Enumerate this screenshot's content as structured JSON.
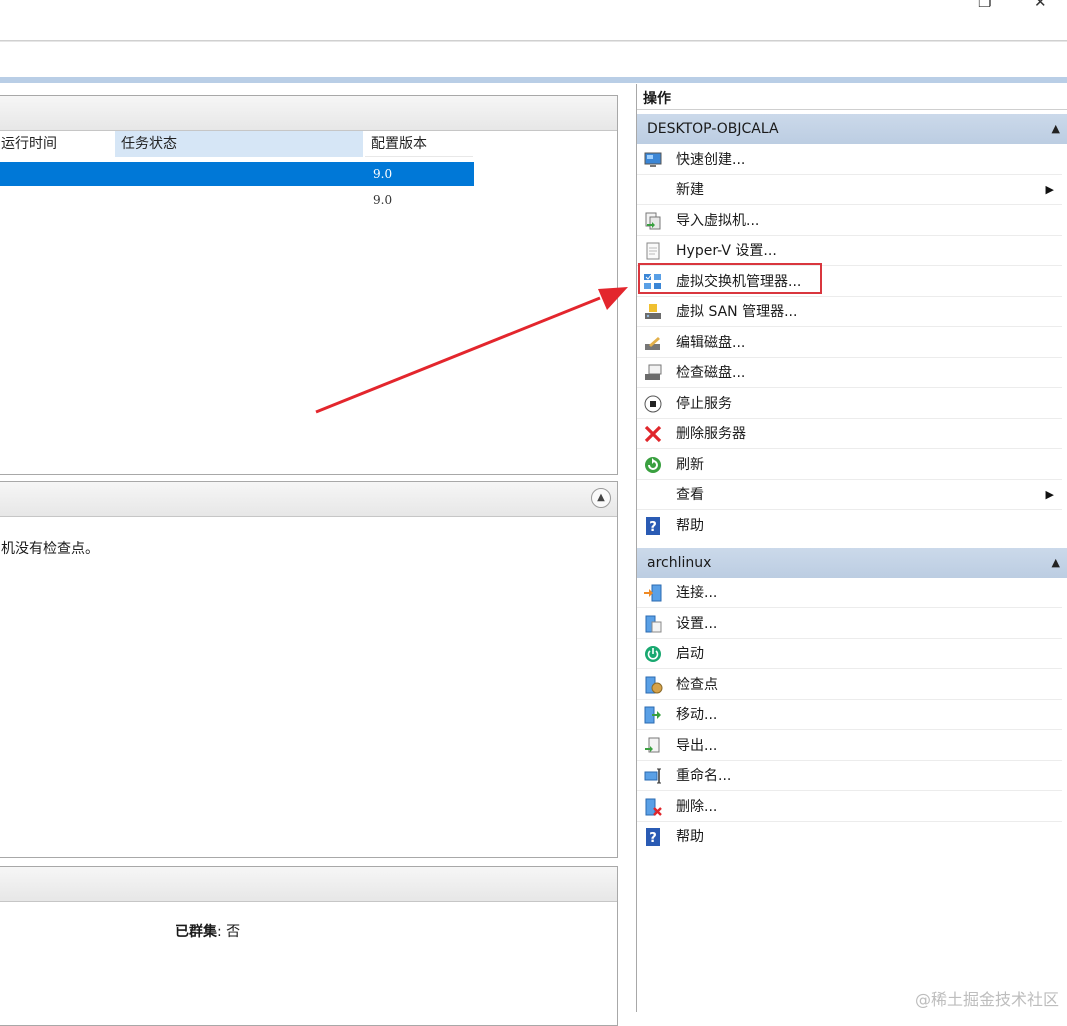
{
  "window": {
    "restore_glyph": "❐",
    "close_glyph": "✕"
  },
  "vm_list": {
    "columns": {
      "uptime": "运行时间",
      "task_status": "任务状态",
      "config_version": "配置版本"
    },
    "rows": [
      {
        "config_version": "9.0",
        "selected": true
      },
      {
        "config_version": "9.0",
        "selected": false
      }
    ]
  },
  "checkpoints": {
    "empty_text": "虚拟机没有检查点。",
    "visible_text": "机没有检查点。"
  },
  "details": {
    "clustered_label": "已群集",
    "clustered_sep": ":",
    "clustered_value": "否"
  },
  "actions": {
    "title": "操作",
    "host_group": {
      "name": "DESKTOP-OBJCALA",
      "items": [
        {
          "label": "快速创建...",
          "icon": "monitor-icon"
        },
        {
          "label": "新建",
          "icon": "none",
          "submenu": true
        },
        {
          "label": "导入虚拟机...",
          "icon": "import-vm-icon"
        },
        {
          "label": "Hyper-V 设置...",
          "icon": "settings-document-icon"
        },
        {
          "label": "虚拟交换机管理器...",
          "icon": "virtual-switch-icon"
        },
        {
          "label": "虚拟 SAN 管理器...",
          "icon": "san-manager-icon"
        },
        {
          "label": "编辑磁盘...",
          "icon": "edit-disk-icon"
        },
        {
          "label": "检查磁盘...",
          "icon": "inspect-disk-icon"
        },
        {
          "label": "停止服务",
          "icon": "stop-icon"
        },
        {
          "label": "删除服务器",
          "icon": "delete-x-icon"
        },
        {
          "label": "刷新",
          "icon": "refresh-icon"
        },
        {
          "label": "查看",
          "icon": "none",
          "submenu": true
        },
        {
          "label": "帮助",
          "icon": "help-icon"
        }
      ]
    },
    "vm_group": {
      "name": "archlinux",
      "items": [
        {
          "label": "连接...",
          "icon": "connect-icon"
        },
        {
          "label": "设置...",
          "icon": "vm-settings-icon"
        },
        {
          "label": "启动",
          "icon": "power-icon"
        },
        {
          "label": "检查点",
          "icon": "checkpoint-icon"
        },
        {
          "label": "移动...",
          "icon": "move-icon"
        },
        {
          "label": "导出...",
          "icon": "export-icon"
        },
        {
          "label": "重命名...",
          "icon": "rename-icon"
        },
        {
          "label": "删除...",
          "icon": "delete-vm-icon"
        },
        {
          "label": "帮助",
          "icon": "help-icon"
        }
      ]
    }
  },
  "watermark": "@稀土掘金技术社区",
  "colors": {
    "selection": "#0078d7",
    "highlight_box": "#d9363e",
    "group_header": "#c4d4e8"
  }
}
